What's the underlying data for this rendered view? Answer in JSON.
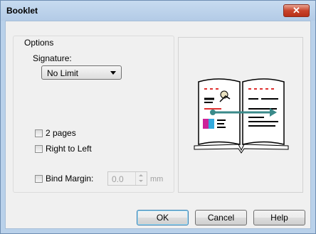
{
  "window": {
    "title": "Booklet",
    "close_label": "✕"
  },
  "options": {
    "group_label": "Options",
    "signature_label": "Signature:",
    "signature_value": "No Limit",
    "two_pages_label": "2 pages",
    "right_to_left_label": "Right to Left",
    "bind_margin_label": "Bind Margin:",
    "bind_margin_value": "0.0",
    "bind_margin_unit": "mm"
  },
  "buttons": {
    "ok": "OK",
    "cancel": "Cancel",
    "help": "Help"
  },
  "colors": {
    "accent_red": "#e03030",
    "teal": "#3a8a8a",
    "cyan": "#33aadd",
    "magenta": "#cc2299"
  }
}
